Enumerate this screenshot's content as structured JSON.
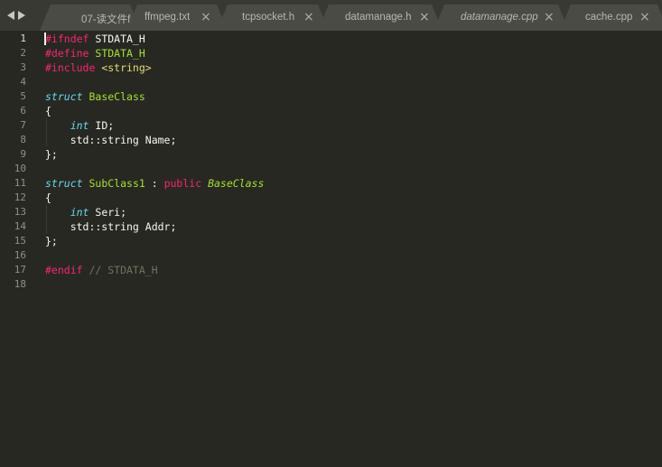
{
  "tabs": [
    {
      "label": "07-读文件f",
      "close": "",
      "active": false,
      "italic": false
    },
    {
      "label": "ffmpeg.txt",
      "close": "×",
      "active": false,
      "italic": false
    },
    {
      "label": "tcpsocket.h",
      "close": "×",
      "active": false,
      "italic": false
    },
    {
      "label": "datamanage.h",
      "close": "×",
      "active": false,
      "italic": false
    },
    {
      "label": "datamanage.cpp",
      "close": "×",
      "active": false,
      "italic": true
    },
    {
      "label": "cache.cpp",
      "close": "×",
      "active": false,
      "italic": false
    }
  ],
  "editor": {
    "current_line": 1,
    "lines": [
      [
        {
          "t": "#ifndef",
          "c": "pre"
        },
        {
          "t": " STDATA_H",
          "c": "plain"
        }
      ],
      [
        {
          "t": "#define",
          "c": "pre"
        },
        {
          "t": " STDATA_H",
          "c": "green"
        }
      ],
      [
        {
          "t": "#include",
          "c": "pre"
        },
        {
          "t": " <string>",
          "c": "str"
        }
      ],
      [],
      [
        {
          "t": "struct",
          "c": "kw-blue"
        },
        {
          "t": " ",
          "c": "plain"
        },
        {
          "t": "BaseClass",
          "c": "green"
        }
      ],
      [
        {
          "t": "{",
          "c": "plain"
        }
      ],
      [
        {
          "t": "    ",
          "c": "plain"
        },
        {
          "t": "int",
          "c": "kw-blue"
        },
        {
          "t": " ID;",
          "c": "plain"
        }
      ],
      [
        {
          "t": "    std::string Name;",
          "c": "plain"
        }
      ],
      [
        {
          "t": "};",
          "c": "plain"
        }
      ],
      [],
      [
        {
          "t": "struct",
          "c": "kw-blue"
        },
        {
          "t": " ",
          "c": "plain"
        },
        {
          "t": "SubClass1",
          "c": "green"
        },
        {
          "t": " : ",
          "c": "plain"
        },
        {
          "t": "public",
          "c": "kw-red"
        },
        {
          "t": " ",
          "c": "plain"
        },
        {
          "t": "BaseClass",
          "c": "green-i"
        }
      ],
      [
        {
          "t": "{",
          "c": "plain"
        }
      ],
      [
        {
          "t": "    ",
          "c": "plain"
        },
        {
          "t": "int",
          "c": "kw-blue"
        },
        {
          "t": " Seri;",
          "c": "plain"
        }
      ],
      [
        {
          "t": "    std::string Addr;",
          "c": "plain"
        }
      ],
      [
        {
          "t": "};",
          "c": "plain"
        }
      ],
      [],
      [
        {
          "t": "#endif",
          "c": "pre"
        },
        {
          "t": " // STDATA_H",
          "c": "comment"
        }
      ],
      []
    ],
    "line_numbers": [
      "1",
      "2",
      "3",
      "4",
      "5",
      "6",
      "7",
      "8",
      "9",
      "10",
      "11",
      "12",
      "13",
      "14",
      "15",
      "16",
      "17",
      "18"
    ]
  },
  "colors": {
    "background": "#272822",
    "tabbar": "#383933",
    "tab": "#4a4b45"
  }
}
